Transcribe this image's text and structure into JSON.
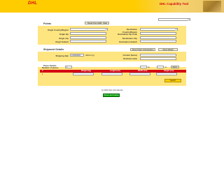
{
  "header": {
    "logo": "DHL",
    "title": "DHL Capability Tool"
  },
  "top_select": {
    "value": ""
  },
  "points": {
    "section_title": "Points",
    "reset_button": "Reset From Address",
    "clear_button": "Clear",
    "origin_country_label": "Origin Country/Region",
    "origin_zip_label": "Origin Zip",
    "origin_city_label": "Origin city",
    "origin_suburb_label": "Origin Suburb",
    "dest_country_label": "Destination Country/Region",
    "dest_zip_label": "Destination Zip Code",
    "dest_city_label": "Destination City",
    "dest_suburb_label": "Destination Suburb"
  },
  "shipment": {
    "section_title": "Shipment Details",
    "about_origin_button": "About Origin & Destination",
    "about_weight_button": "About Weight",
    "shipping_date_label": "Shipping date",
    "shipping_date_value": "14/12/2022",
    "date_format": "(dd/mm/yy)",
    "content_label1": "Content (items)",
    "content_label2": "Declared value"
  },
  "pieces": {
    "section_title": "Piece Details",
    "number_label": "Number of pieces",
    "number_value": "1",
    "unit1": "kg",
    "unit2": "cm",
    "metric_label": "Metric",
    "col1": "#",
    "col2": "Weight (kg)",
    "col3": "Length (cm)",
    "col4": "Width (cm)",
    "col5": "Height (cm)",
    "row_num": "1",
    "search_button": "Search"
  },
  "footer": {
    "copyright": "(c) 2022 DHL International",
    "ok_button": "Privacy and Cookies"
  }
}
